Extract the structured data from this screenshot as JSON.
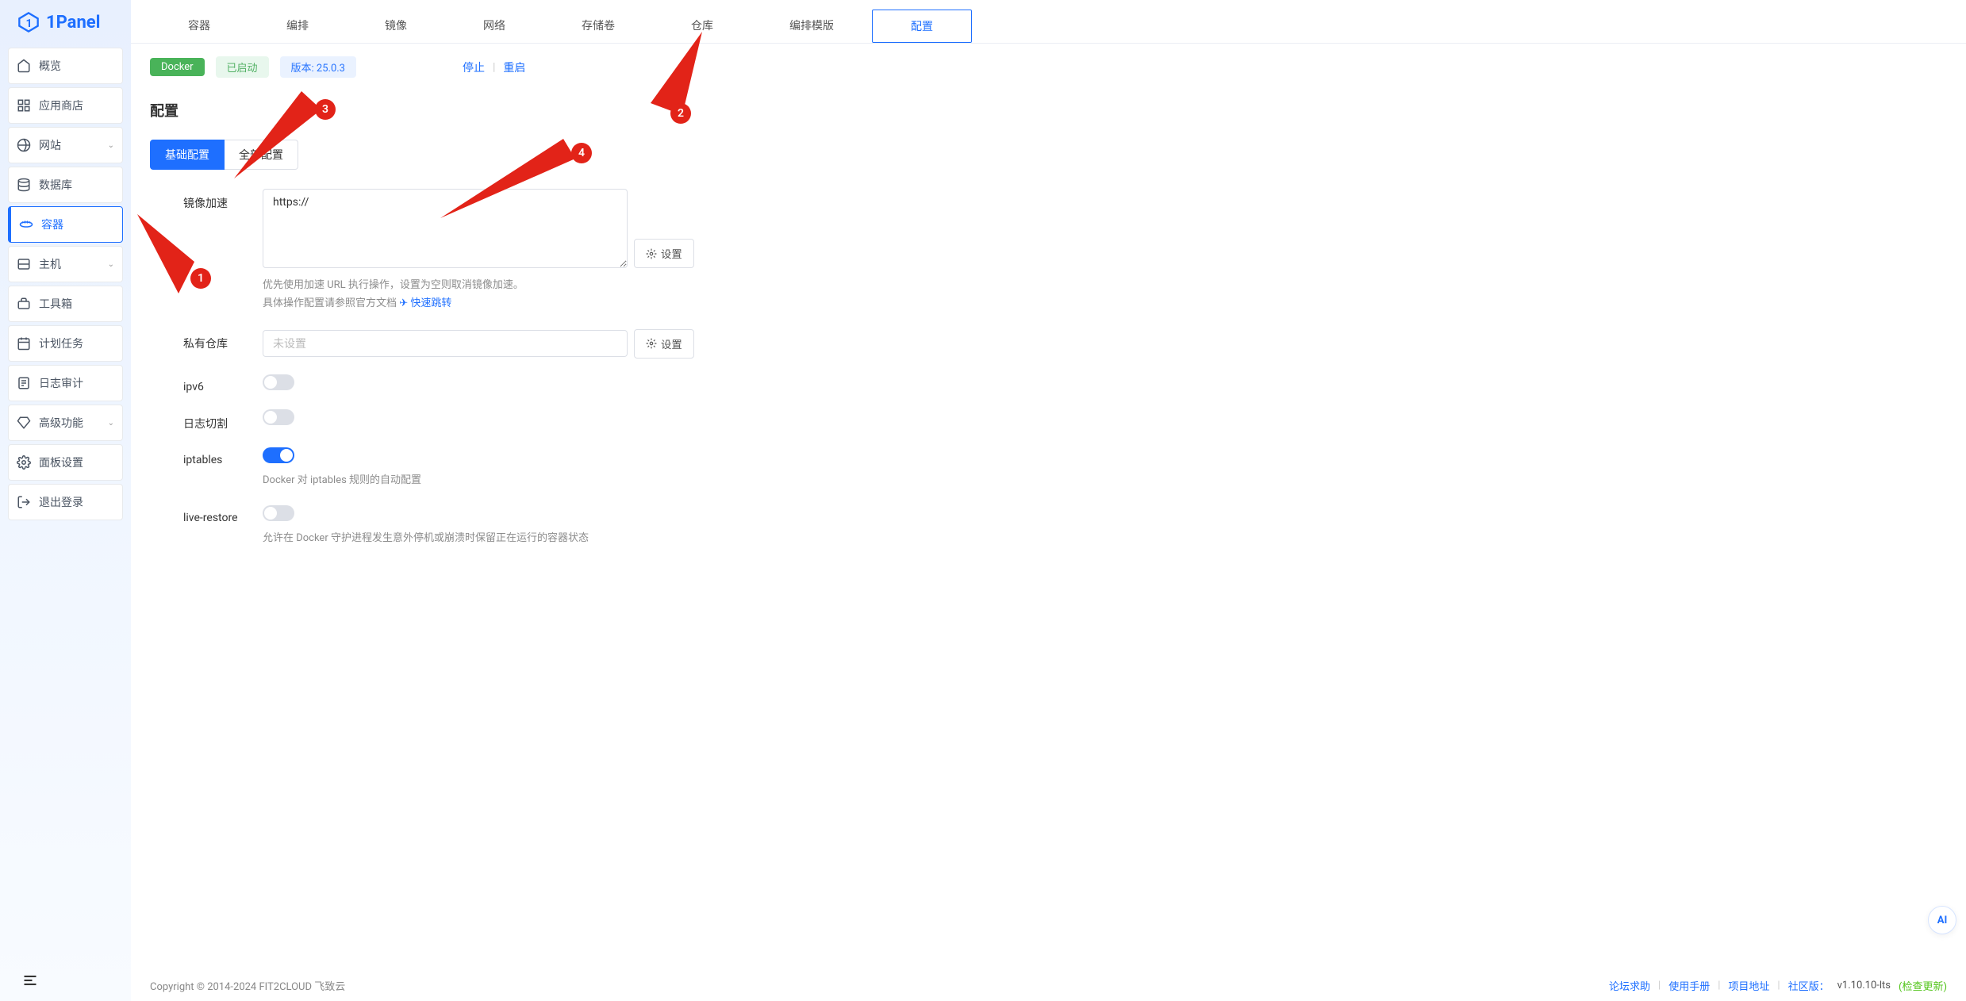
{
  "logo": {
    "text": "1Panel"
  },
  "sidebar": {
    "items": [
      {
        "label": "概览"
      },
      {
        "label": "应用商店"
      },
      {
        "label": "网站",
        "expandable": true
      },
      {
        "label": "数据库"
      },
      {
        "label": "容器"
      },
      {
        "label": "主机",
        "expandable": true
      },
      {
        "label": "工具箱"
      },
      {
        "label": "计划任务"
      },
      {
        "label": "日志审计"
      },
      {
        "label": "高级功能",
        "expandable": true
      },
      {
        "label": "面板设置"
      },
      {
        "label": "退出登录"
      }
    ]
  },
  "tabs": {
    "items": [
      {
        "label": "容器"
      },
      {
        "label": "编排"
      },
      {
        "label": "镜像"
      },
      {
        "label": "网络"
      },
      {
        "label": "存储卷"
      },
      {
        "label": "仓库"
      },
      {
        "label": "编排模版"
      },
      {
        "label": "配置"
      }
    ]
  },
  "status": {
    "docker": "Docker",
    "running": "已启动",
    "version": "版本: 25.0.3",
    "stop": "停止",
    "restart": "重启"
  },
  "page": {
    "title": "配置"
  },
  "subtabs": {
    "basic": "基础配置",
    "all": "全部配置"
  },
  "form": {
    "mirror": {
      "label": "镜像加速",
      "value": "https://",
      "settings": "设置",
      "help1": "优先使用加速 URL 执行操作，设置为空则取消镜像加速。",
      "help2": "具体操作配置请参照官方文档 ",
      "help2_link": "快速跳转"
    },
    "registry": {
      "label": "私有仓库",
      "placeholder": "未设置",
      "settings": "设置"
    },
    "ipv6": {
      "label": "ipv6"
    },
    "logcut": {
      "label": "日志切割"
    },
    "iptables": {
      "label": "iptables",
      "help": "Docker 对 iptables 规则的自动配置"
    },
    "liverestore": {
      "label": "live-restore",
      "help": "允许在 Docker 守护进程发生意外停机或崩溃时保留正在运行的容器状态"
    }
  },
  "annotations": {
    "n1": "1",
    "n2": "2",
    "n3": "3",
    "n4": "4"
  },
  "floating": {
    "ai": "AI"
  },
  "footer": {
    "copyright": "Copyright © 2014-2024 FIT2CLOUD 飞致云",
    "forum": "论坛求助",
    "manual": "使用手册",
    "project": "项目地址",
    "edition": "社区版：",
    "version": "v1.10.10-lts",
    "update": "(检查更新)"
  }
}
